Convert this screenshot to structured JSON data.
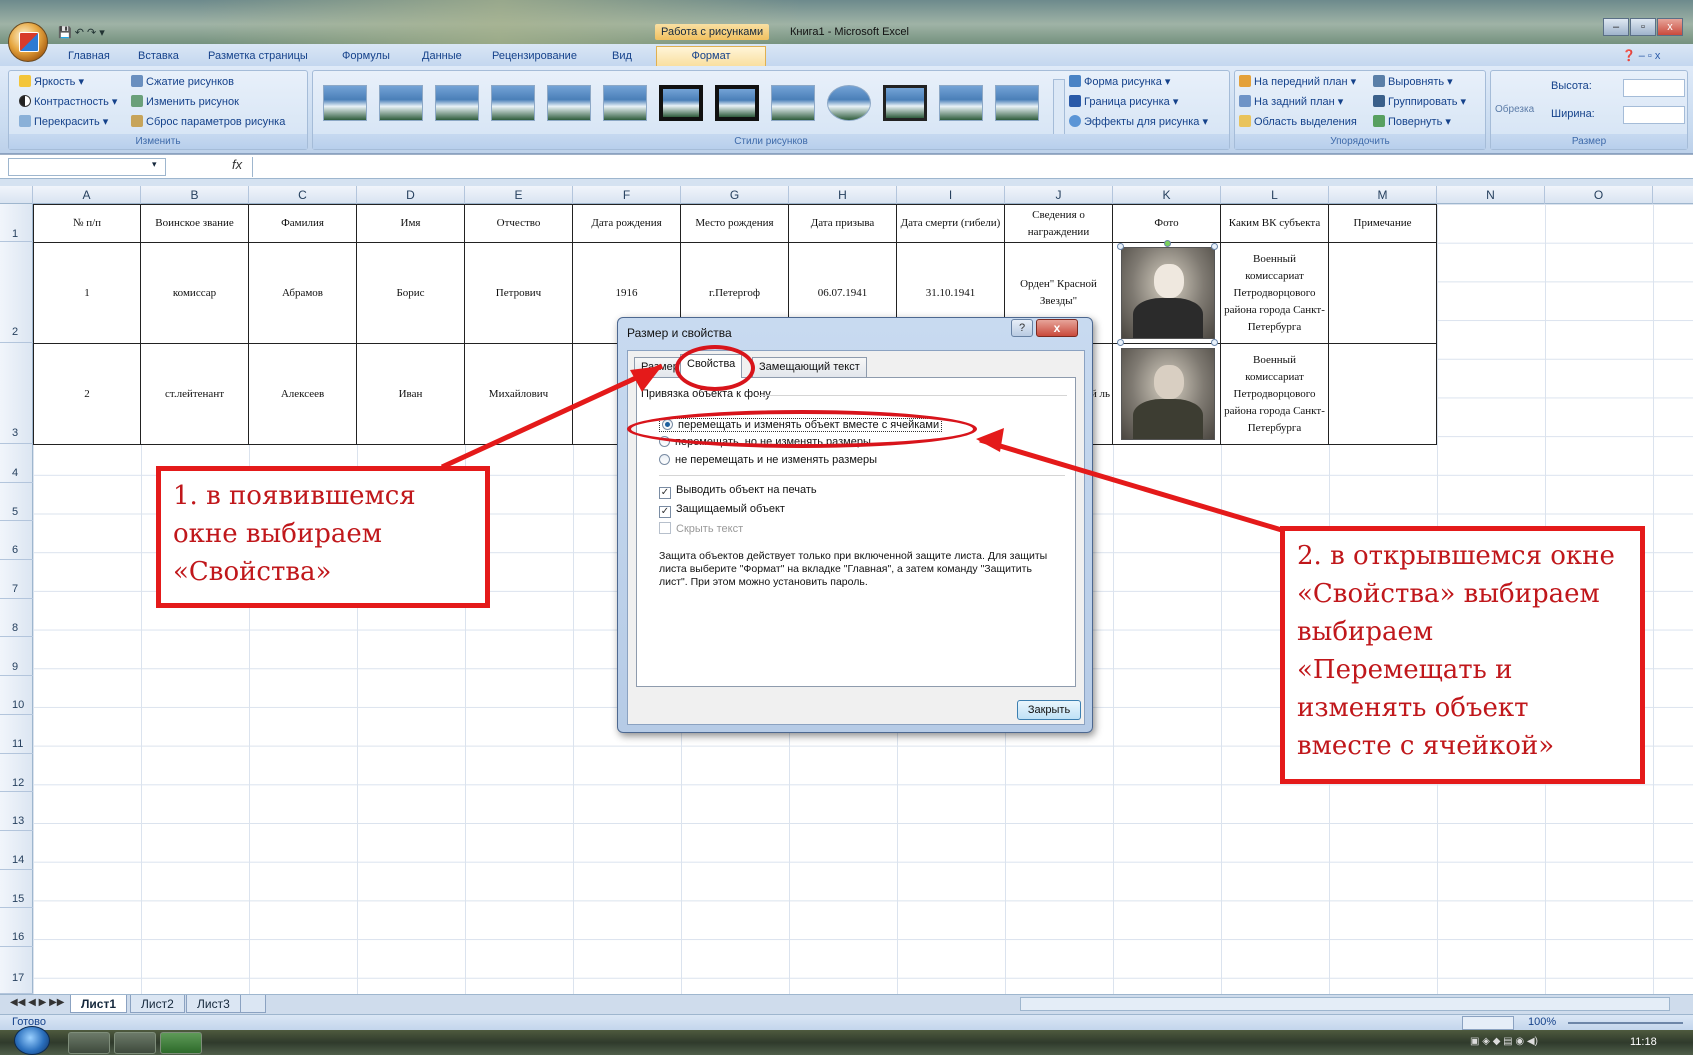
{
  "window": {
    "title_tools": "Работа с рисунками",
    "title_doc": "Книга1 - Microsoft Excel",
    "btn_min": "–",
    "btn_max": "▫",
    "btn_close": "x"
  },
  "ribbon_tabs": [
    "Главная",
    "Вставка",
    "Разметка страницы",
    "Формулы",
    "Данные",
    "Рецензирование",
    "Вид"
  ],
  "ribbon_tab_active": "Формат",
  "ribbon": {
    "adjust": {
      "brightness": "Яркость ▾",
      "contrast": "Контрастность ▾",
      "recolor": "Перекрасить ▾",
      "compress": "Сжатие рисунков",
      "change": "Изменить рисунок",
      "reset": "Сброс параметров рисунка",
      "label": "Изменить"
    },
    "styles": {
      "label": "Стили рисунков",
      "shape": "Форма рисунка ▾",
      "border": "Граница рисунка ▾",
      "effects": "Эффекты для рисунка ▾"
    },
    "arrange": {
      "front": "На передний план ▾",
      "back": "На задний план ▾",
      "selection": "Область выделения",
      "align": "Выровнять ▾",
      "group": "Группировать ▾",
      "rotate": "Повернуть ▾",
      "label": "Упорядочить"
    },
    "size": {
      "crop": "Обрезка",
      "height": "Высота:",
      "width": "Ширина:",
      "label": "Размер"
    }
  },
  "formula_bar": {
    "fx": "fx"
  },
  "columns": [
    "A",
    "B",
    "C",
    "D",
    "E",
    "F",
    "G",
    "H",
    "I",
    "J",
    "K",
    "L",
    "M",
    "N",
    "O"
  ],
  "row_numbers": [
    "1",
    "2",
    "3",
    "4",
    "5",
    "6",
    "7",
    "8",
    "9",
    "10",
    "11",
    "12",
    "13",
    "14",
    "15",
    "16",
    "17"
  ],
  "table": {
    "headers": [
      "№ п/п",
      "Воинское звание",
      "Фамилия",
      "Имя",
      "Отчество",
      "Дата рождения",
      "Место рождения",
      "Дата призыва",
      "Дата смерти (гибели)",
      "Сведения о награждении",
      "Фото",
      "Каким ВК субъекта",
      "Примечание"
    ],
    "rows": [
      [
        "1",
        "комиссар",
        "Абрамов",
        "Борис",
        "Петрович",
        "1916",
        "г.Петергоф",
        "06.07.1941",
        "31.10.1941",
        "Орден\" Красной Звезды\"",
        "",
        "Военный комиссариат Петродворцового района города Санкт-Петербурга",
        ""
      ],
      [
        "2",
        "ст.лейтенант",
        "Алексеев",
        "Иван",
        "Михайлович",
        "",
        "",
        "",
        "",
        "ой ль",
        "",
        "Военный комиссариат Петродворцового района города Санкт-Петербурга",
        ""
      ]
    ]
  },
  "dialog": {
    "title": "Размер и свойства",
    "help": "?",
    "close_x": "x",
    "tabs": [
      "Размер",
      "Свойства",
      "Замещающий текст"
    ],
    "group_label": "Привязка объекта к фону",
    "radio_1": "перемещать и изменять объект вместе с ячейками",
    "radio_2": "перемещать, но не изменять размеры",
    "radio_3": "не перемещать и не изменять размеры",
    "check_print": "Выводить объект на печать",
    "check_locked": "Защищаемый объект",
    "check_hide": "Скрыть текст",
    "note": "Защита объектов действует только при включенной защите листа. Для защиты листа выберите \"Формат\" на вкладке \"Главная\", а затем команду \"Защитить лист\". При этом можно установить пароль.",
    "close_button": "Закрыть"
  },
  "sheet_tabs": [
    "Лист1",
    "Лист2",
    "Лист3"
  ],
  "status": {
    "ready": "Готово",
    "zoom": "100%"
  },
  "taskbar": {
    "clock": "11:18"
  },
  "callouts": {
    "first": "1. в появившемся окне выбираем «Свойства»",
    "second": "2. в открывшемся окне «Свойства» выбираем выбираем «Перемещать и изменять объект вместе с ячейкой»"
  },
  "colors": {
    "annotation_red": "#e41a1a",
    "ribbon_blue": "#15428b",
    "format_tab": "#f9dfa0"
  }
}
